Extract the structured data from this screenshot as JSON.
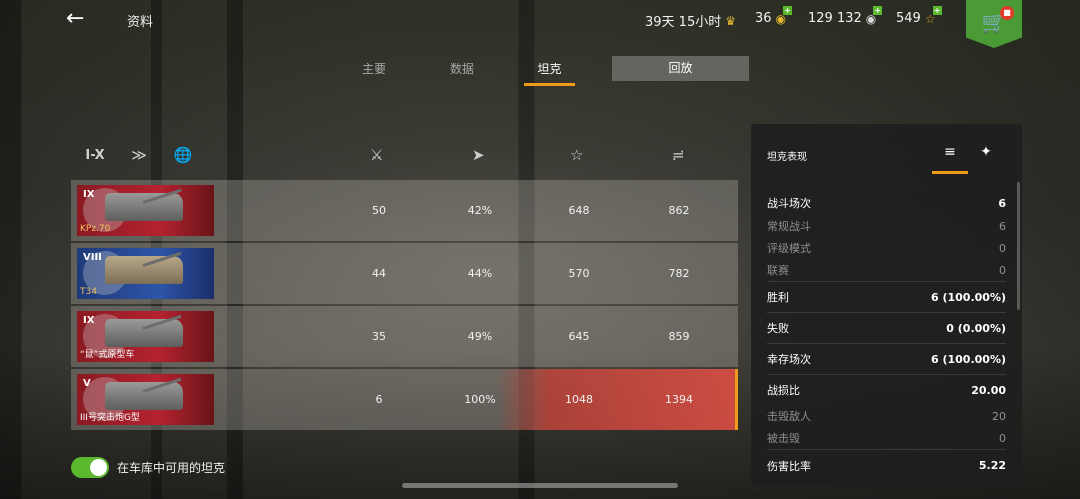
{
  "header": {
    "title": "资料",
    "timer": "39天 15小时",
    "gold": "36",
    "credits": "129 132",
    "free_xp": "549"
  },
  "tabs": [
    {
      "label": "主要",
      "active": false
    },
    {
      "label": "数据",
      "active": false
    },
    {
      "label": "坦克",
      "active": true
    }
  ],
  "replay_label": "回放",
  "filters": {
    "tier_label": "I-X"
  },
  "table": {
    "rows": [
      {
        "tier": "IX",
        "name": "KPz.70",
        "nation": "germany",
        "battles": "50",
        "winrate": "42%",
        "avg_xp": "648",
        "avg_damage": "862",
        "selected": false
      },
      {
        "tier": "VIII",
        "name": "T34",
        "nation": "usa",
        "battles": "44",
        "winrate": "44%",
        "avg_xp": "570",
        "avg_damage": "782",
        "selected": false
      },
      {
        "tier": "IX",
        "name": "“鼠”式原型车",
        "nation": "germany",
        "battles": "35",
        "winrate": "49%",
        "avg_xp": "645",
        "avg_damage": "859",
        "selected": false
      },
      {
        "tier": "V",
        "name": "III号突击炮G型",
        "nation": "germany",
        "battles": "6",
        "winrate": "100%",
        "avg_xp": "1048",
        "avg_damage": "1394",
        "selected": true
      }
    ]
  },
  "toggle_label": "在车库中可用的坦克",
  "panel": {
    "title": "坦克表现",
    "stats": [
      {
        "label": "战斗场次",
        "value": "6",
        "kind": "main"
      },
      {
        "label": "常规战斗",
        "value": "6",
        "kind": "sub"
      },
      {
        "label": "评级模式",
        "value": "0",
        "kind": "sub"
      },
      {
        "label": "联赛",
        "value": "0",
        "kind": "sub"
      },
      {
        "label": "胜利",
        "value": "6 (100.00%)",
        "kind": "main"
      },
      {
        "label": "失败",
        "value": "0 (0.00%)",
        "kind": "main"
      },
      {
        "label": "幸存场次",
        "value": "6 (100.00%)",
        "kind": "main"
      },
      {
        "label": "战损比",
        "value": "20.00",
        "kind": "main"
      },
      {
        "label": "击毁敌人",
        "value": "20",
        "kind": "sub"
      },
      {
        "label": "被击毁",
        "value": "0",
        "kind": "sub"
      },
      {
        "label": "伤害比率",
        "value": "5.22",
        "kind": "main"
      }
    ]
  }
}
